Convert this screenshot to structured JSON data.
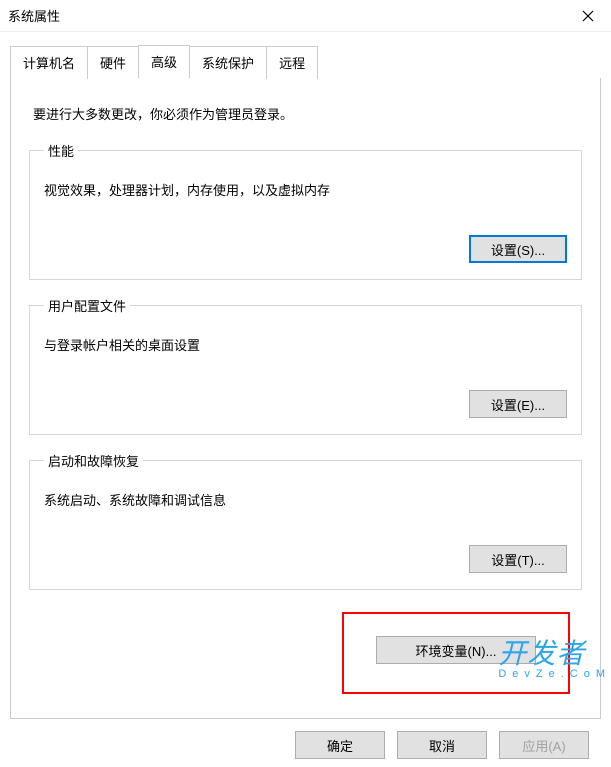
{
  "window": {
    "title": "系统属性"
  },
  "tabs": {
    "computer_name": "计算机名",
    "hardware": "硬件",
    "advanced": "高级",
    "system_protection": "系统保护",
    "remote": "远程"
  },
  "advanced_tab": {
    "admin_note": "要进行大多数更改，你必须作为管理员登录。",
    "performance": {
      "legend": "性能",
      "desc": "视觉效果，处理器计划，内存使用，以及虚拟内存",
      "button": "设置(S)..."
    },
    "user_profiles": {
      "legend": "用户配置文件",
      "desc": "与登录帐户相关的桌面设置",
      "button": "设置(E)..."
    },
    "startup_recovery": {
      "legend": "启动和故障恢复",
      "desc": "系统启动、系统故障和调试信息",
      "button": "设置(T)..."
    },
    "env_vars_button": "环境变量(N)..."
  },
  "footer": {
    "ok": "确定",
    "cancel": "取消",
    "apply": "应用(A)"
  },
  "watermark": {
    "main": "开发者",
    "sub": "DevZe.CoM"
  }
}
